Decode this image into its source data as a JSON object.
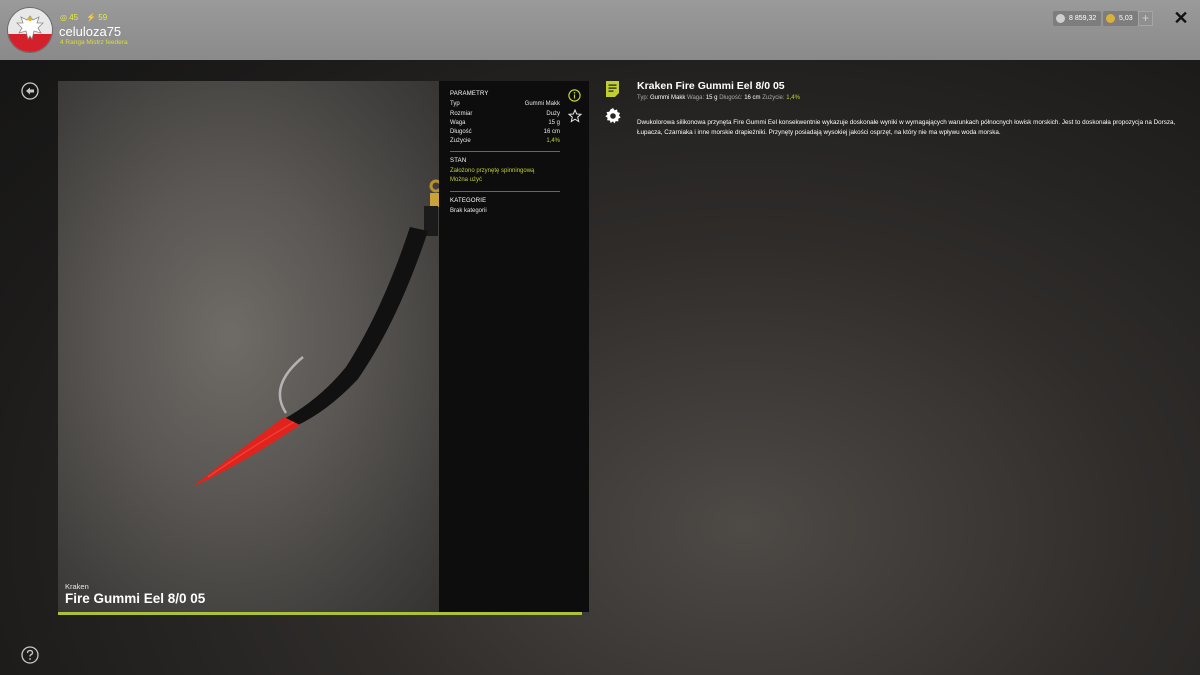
{
  "player": {
    "username": "celuloza75",
    "stat_one": "45",
    "stat_two": "59",
    "rank": "4 Ranga Mistrz feedera"
  },
  "currency": {
    "silver": "8 859,32",
    "gold": "5,03",
    "plus": "+"
  },
  "close_label": "✕",
  "photo": {
    "brand": "Kraken",
    "name": "Fire Gummi Eel 8/0 05"
  },
  "params": {
    "title": "PARAMETRY",
    "rows": [
      {
        "label": "Typ",
        "value": "Gummi Makk"
      },
      {
        "label": "Rozmiar",
        "value": "Duży"
      },
      {
        "label": "Waga",
        "value": "15 g"
      },
      {
        "label": "Długość",
        "value": "16 cm"
      },
      {
        "label": "Zużycie",
        "value": "1,4%"
      }
    ],
    "state_title": "STAN",
    "state_lines": [
      "Założono przynętę spinningową",
      "Można użyć"
    ],
    "category_title": "KATEGORIE",
    "category_value": "Brak kategorii"
  },
  "wear_progress": 0.986,
  "item": {
    "title": "Kraken Fire Gummi Eel 8/0 05",
    "sub": {
      "type_label": "Typ:",
      "type_value": "Gummi Makk",
      "weight_label": "Waga:",
      "weight_value": "15 g",
      "length_label": "Długość:",
      "length_value": "16 cm",
      "wear_label": "Zużycie:",
      "wear_value": "1,4%"
    },
    "description": "Dwukolorowa silikonowa przynęta Fire Gummi Eel konsekwentnie wykazuje doskonałe wyniki w wymagających warunkach północnych łowisk morskich. Jest to doskonała propozycja na Dorsza, Łupacza, Czarniaka i inne morskie drapieżniki. Przynęty posiadają wysokiej jakości osprzęt, na który nie ma wpływu woda morska."
  },
  "colors": {
    "accent": "#bfcf33",
    "progress": "#a9c23a",
    "lure_red": "#e0241d"
  }
}
